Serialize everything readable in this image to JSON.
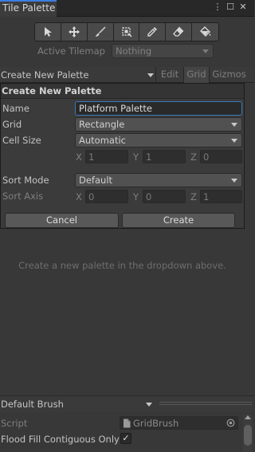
{
  "window": {
    "tab_title": "Tile Palette",
    "menu_glyph": "⋮",
    "maximize_glyph": "☐",
    "close_glyph": "✕"
  },
  "toolbar": {
    "tools": [
      {
        "name": "select-icon"
      },
      {
        "name": "move-icon"
      },
      {
        "name": "paint-brush-icon"
      },
      {
        "name": "box-fill-icon"
      },
      {
        "name": "picker-icon"
      },
      {
        "name": "eraser-icon"
      },
      {
        "name": "fill-bucket-icon"
      }
    ]
  },
  "active_tilemap": {
    "label": "Active Tilemap",
    "value": "Nothing"
  },
  "palette_bar": {
    "dropdown_value": "Create New Palette",
    "edit_label": "Edit",
    "grid_label": "Grid",
    "gizmos_label": "Gizmos"
  },
  "create_palette": {
    "header": "Create New Palette",
    "name_label": "Name",
    "name_value": "Platform Palette",
    "grid_label": "Grid",
    "grid_value": "Rectangle",
    "cell_size_label": "Cell Size",
    "cell_size_value": "Automatic",
    "cell_size_xyz": {
      "x_label": "X",
      "x": "1",
      "y_label": "Y",
      "y": "1",
      "z_label": "Z",
      "z": "0"
    },
    "sort_mode_label": "Sort Mode",
    "sort_mode_value": "Default",
    "sort_axis_label": "Sort Axis",
    "sort_axis_xyz": {
      "x_label": "X",
      "x": "0",
      "y_label": "Y",
      "y": "0",
      "z_label": "Z",
      "z": "1"
    },
    "cancel_label": "Cancel",
    "create_label": "Create"
  },
  "empty_message": "Create a new palette in the dropdown above.",
  "brush": {
    "dropdown_value": "Default Brush",
    "script_label": "Script",
    "script_value": "GridBrush",
    "flood_fill_label": "Flood Fill Contiguous Only",
    "flood_fill_checked": true,
    "check_glyph": "✓"
  },
  "colors": {
    "accent": "#3d7de0",
    "background": "#383838",
    "focus_border": "#3a79bb"
  }
}
